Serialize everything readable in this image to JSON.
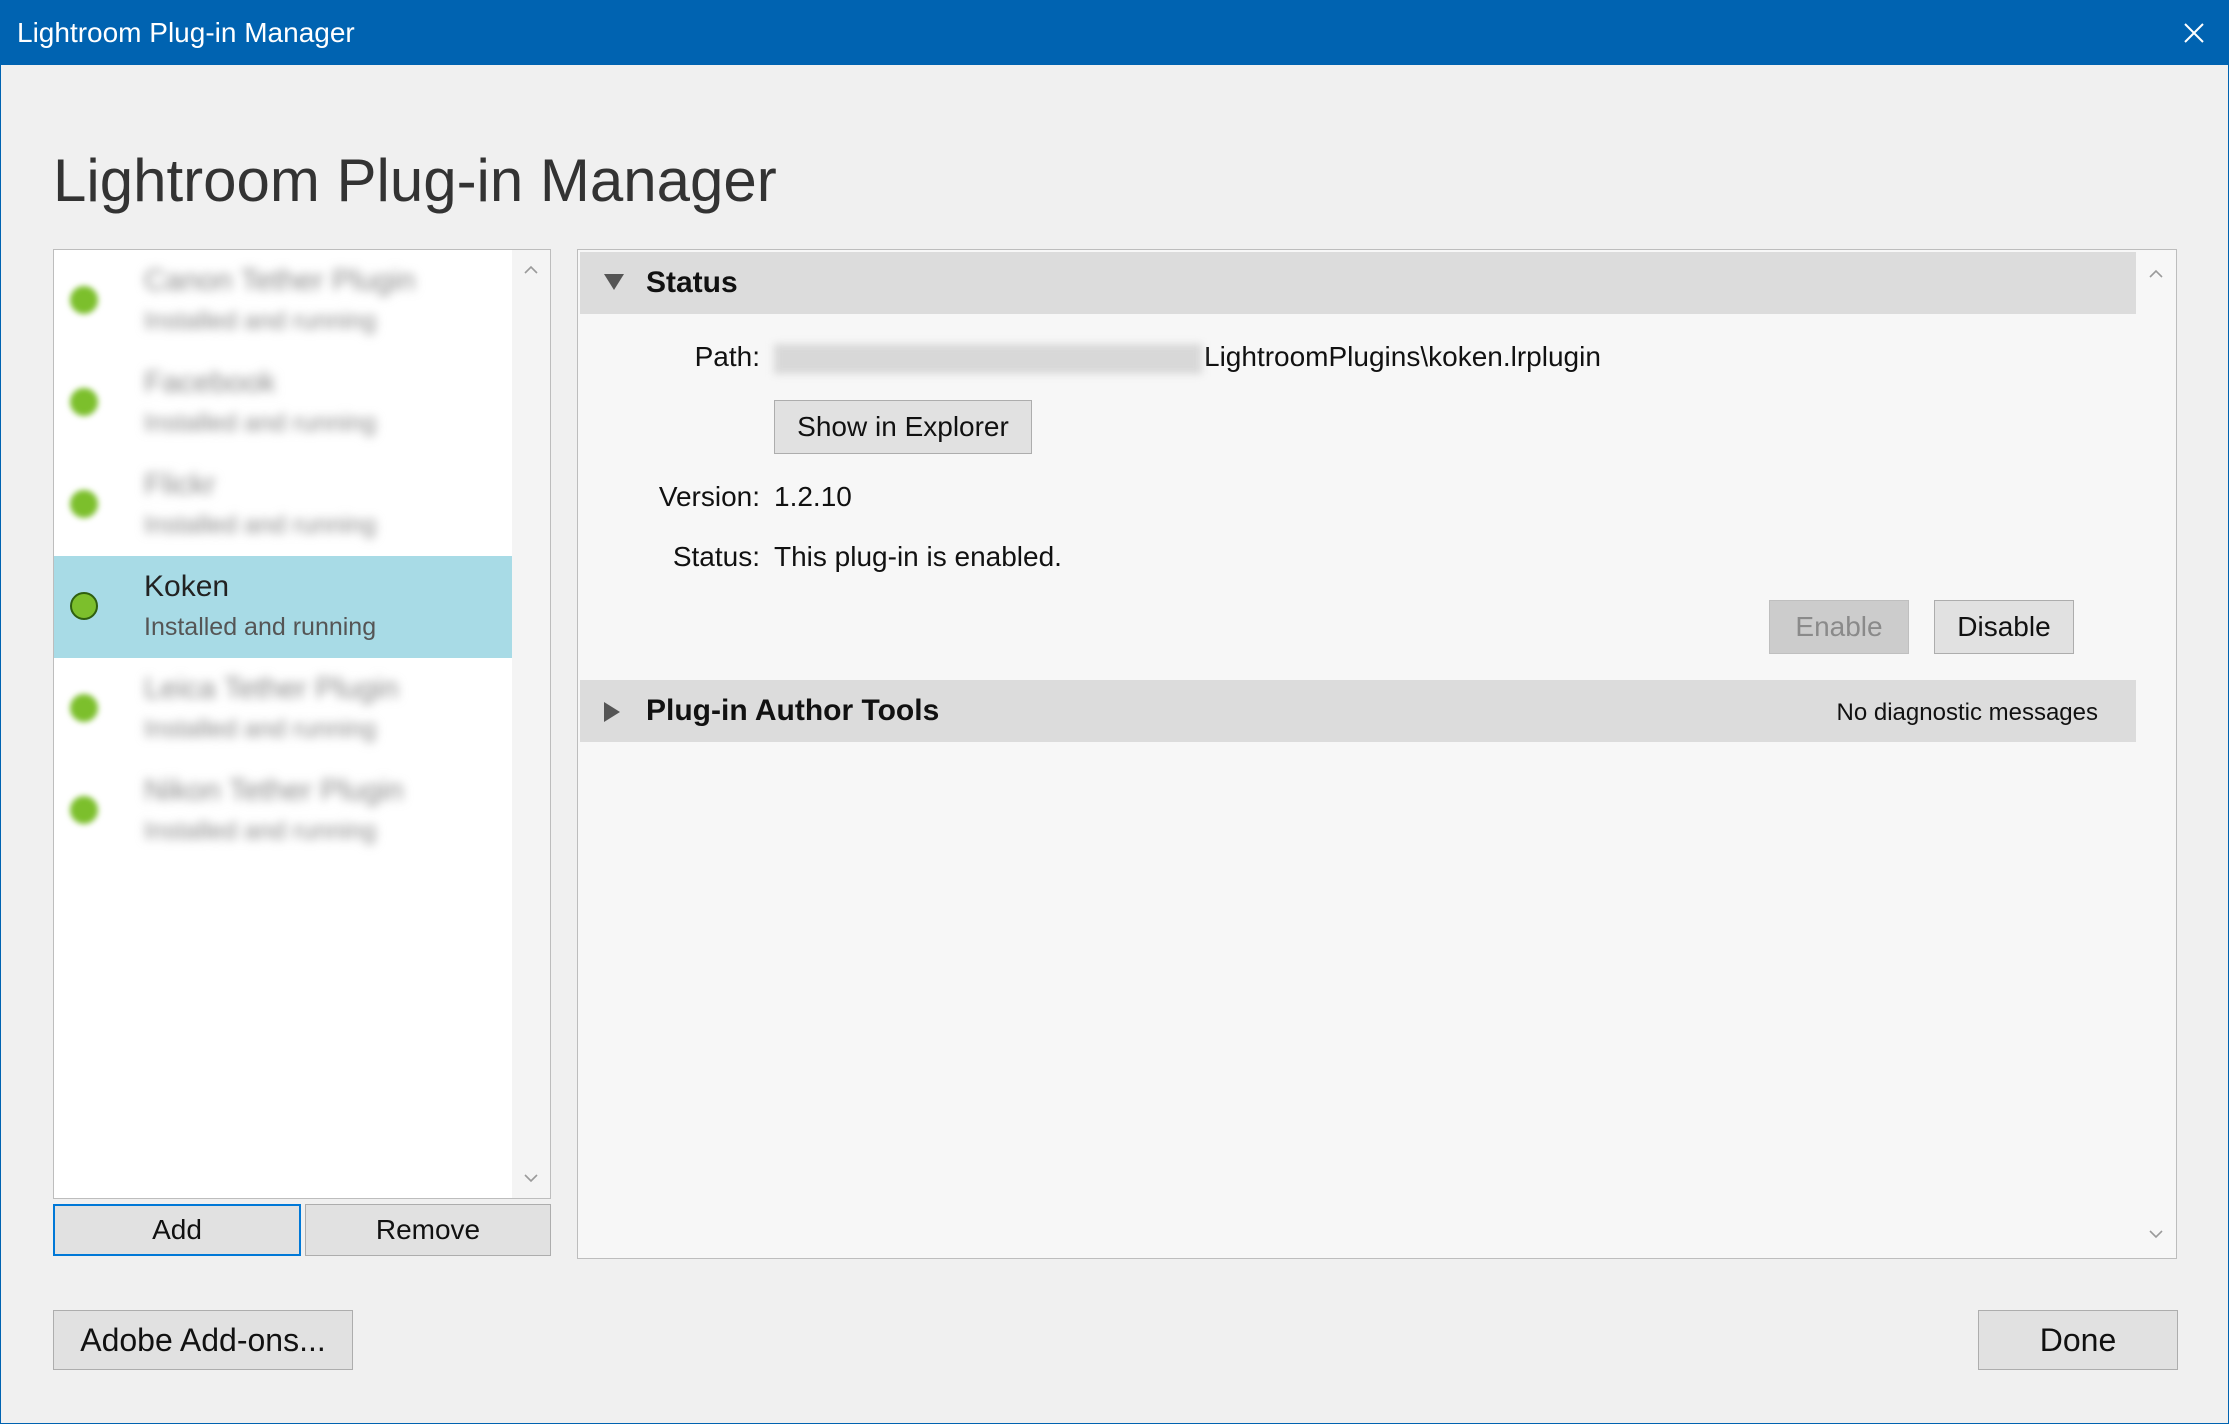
{
  "window": {
    "title": "Lightroom Plug-in Manager",
    "close_icon": "close-icon",
    "accent_color": "#0063b1"
  },
  "page": {
    "heading": "Lightroom Plug-in Manager"
  },
  "plugin_list": {
    "items": [
      {
        "name": "Canon Tether Plugin",
        "status": "Installed and running",
        "blurred": true
      },
      {
        "name": "Facebook",
        "status": "Installed and running",
        "blurred": true
      },
      {
        "name": "Flickr",
        "status": "Installed and running",
        "blurred": true
      },
      {
        "name": "Koken",
        "status": "Installed and running",
        "blurred": false,
        "selected": true
      },
      {
        "name": "Leica Tether Plugin",
        "status": "Installed and running",
        "blurred": true
      },
      {
        "name": "Nikon Tether Plugin",
        "status": "Installed and running",
        "blurred": true
      }
    ],
    "selected_color": "#a8dbe6",
    "status_dot_color": "#7cbf2c",
    "add_label": "Add",
    "remove_label": "Remove"
  },
  "status_section": {
    "header": "Status",
    "path_label": "Path:",
    "path_value": "LightroomPlugins\\koken.lrplugin",
    "show_in_explorer_label": "Show in Explorer",
    "version_label": "Version:",
    "version_value": "1.2.10",
    "status_label": "Status:",
    "status_value": "This plug-in is enabled.",
    "enable_label": "Enable",
    "disable_label": "Disable"
  },
  "author_tools_section": {
    "header": "Plug-in Author Tools",
    "diagnostic_note": "No diagnostic messages"
  },
  "footer": {
    "addons_label": "Adobe Add-ons...",
    "done_label": "Done"
  }
}
